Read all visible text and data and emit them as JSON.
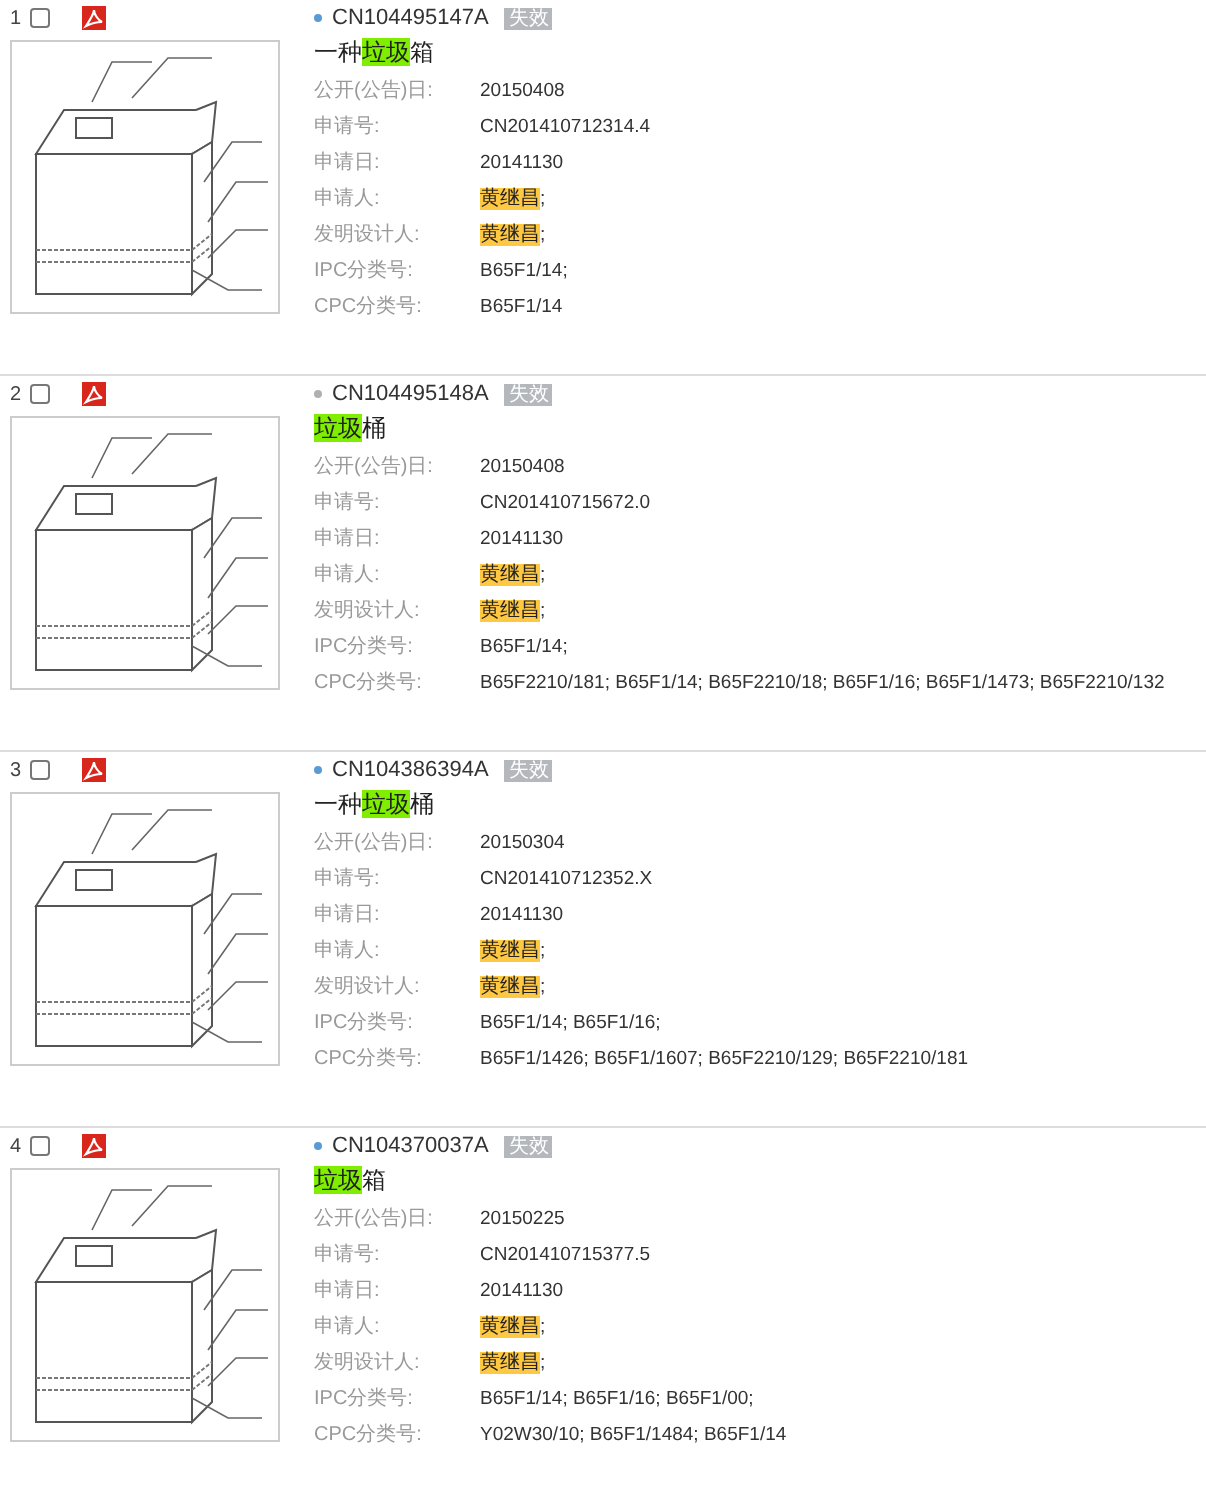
{
  "records": [
    {
      "index": "1",
      "checked": false,
      "thumbnail": {
        "kind": "picture"
      },
      "color": "#5b9bd5",
      "number": "CN104495147A",
      "status": "失效",
      "title": [
        {
          "text": "一种",
          "highlight": false
        },
        {
          "text": "垃圾",
          "highlight": true
        },
        {
          "text": "箱",
          "highlight": false
        }
      ],
      "fields": [
        {
          "label": "公开(公告)日:",
          "value": "20150408"
        },
        {
          "label": "申请号:",
          "value": "CN201410712314.4"
        },
        {
          "label": "申请日:",
          "value": "20141130"
        },
        {
          "label": "申请人:",
          "value": [
            {
              "text": "黄继昌",
              "highlight": true
            },
            {
              "text": ";",
              "highlight": false
            }
          ]
        },
        {
          "label": "发明设计人:",
          "value": [
            {
              "text": "黄继昌",
              "highlight": true
            },
            {
              "text": ";",
              "highlight": false
            }
          ]
        },
        {
          "label": "IPC分类号:",
          "value": "B65F1/14;"
        },
        {
          "label": "CPC分类号:",
          "value": "B65F1/14"
        }
      ]
    },
    {
      "index": "2",
      "checked": false,
      "thumbnail": {
        "kind": "picture"
      },
      "color": "#b0b0b0",
      "number": "CN104495148A",
      "status": "失效",
      "title": [
        {
          "text": "垃圾",
          "highlight": true
        },
        {
          "text": "桶",
          "highlight": false
        }
      ],
      "fields": [
        {
          "label": "公开(公告)日:",
          "value": "20150408"
        },
        {
          "label": "申请号:",
          "value": "CN201410715672.0"
        },
        {
          "label": "申请日:",
          "value": "20141130"
        },
        {
          "label": "申请人:",
          "value": [
            {
              "text": "黄继昌",
              "highlight": true
            },
            {
              "text": ";",
              "highlight": false
            }
          ]
        },
        {
          "label": "发明设计人:",
          "value": [
            {
              "text": "黄继昌",
              "highlight": true
            },
            {
              "text": ";",
              "highlight": false
            }
          ]
        },
        {
          "label": "IPC分类号:",
          "value": "B65F1/14;"
        },
        {
          "label": "CPC分类号:",
          "value": "B65F2210/181; B65F1/14; B65F2210/18; B65F1/16; B65F1/1473; B65F2210/132"
        }
      ]
    },
    {
      "index": "3",
      "checked": false,
      "thumbnail": {
        "kind": "picture"
      },
      "color": "#5b9bd5",
      "number": "CN104386394A",
      "status": "失效",
      "title": [
        {
          "text": "一种",
          "highlight": false
        },
        {
          "text": "垃圾",
          "highlight": true
        },
        {
          "text": "桶",
          "highlight": false
        }
      ],
      "fields": [
        {
          "label": "公开(公告)日:",
          "value": "20150304"
        },
        {
          "label": "申请号:",
          "value": "CN201410712352.X"
        },
        {
          "label": "申请日:",
          "value": "20141130"
        },
        {
          "label": "申请人:",
          "value": [
            {
              "text": "黄继昌",
              "highlight": true
            },
            {
              "text": ";",
              "highlight": false
            }
          ]
        },
        {
          "label": "发明设计人:",
          "value": [
            {
              "text": "黄继昌",
              "highlight": true
            },
            {
              "text": ";",
              "highlight": false
            }
          ]
        },
        {
          "label": "IPC分类号:",
          "value": "B65F1/14; B65F1/16;"
        },
        {
          "label": "CPC分类号:",
          "value": "B65F1/1426; B65F1/1607; B65F2210/129; B65F2210/181"
        }
      ]
    },
    {
      "index": "4",
      "checked": false,
      "thumbnail": {
        "kind": "picture"
      },
      "color": "#5b9bd5",
      "number": "CN104370037A",
      "status": "失效",
      "title": [
        {
          "text": "垃圾",
          "highlight": true
        },
        {
          "text": "箱",
          "highlight": false
        }
      ],
      "fields": [
        {
          "label": "公开(公告)日:",
          "value": "20150225"
        },
        {
          "label": "申请号:",
          "value": "CN201410715377.5"
        },
        {
          "label": "申请日:",
          "value": "20141130"
        },
        {
          "label": "申请人:",
          "value": [
            {
              "text": "黄继昌",
              "highlight": true
            },
            {
              "text": ";",
              "highlight": false
            }
          ]
        },
        {
          "label": "发明设计人:",
          "value": [
            {
              "text": "黄继昌",
              "highlight": true
            },
            {
              "text": ";",
              "highlight": false
            }
          ]
        },
        {
          "label": "IPC分类号:",
          "value": "B65F1/14; B65F1/16; B65F1/00;"
        },
        {
          "label": "CPC分类号:",
          "value": "Y02W30/10; B65F1/1484; B65F1/14"
        }
      ]
    }
  ]
}
